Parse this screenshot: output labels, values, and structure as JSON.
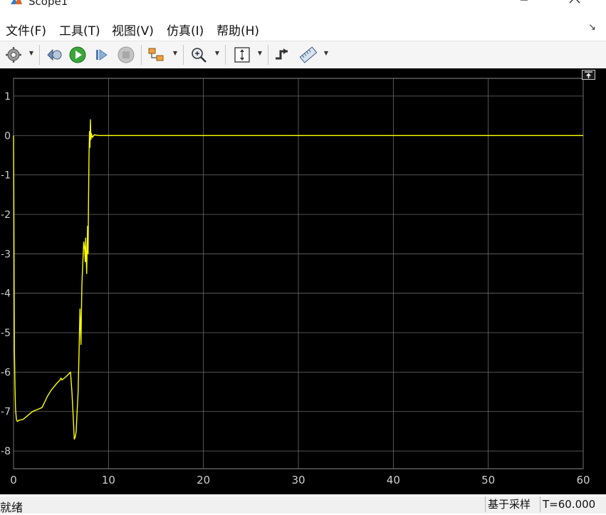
{
  "window": {
    "title": "Scope1"
  },
  "menu": {
    "items": [
      "文件(F)",
      "工具(T)",
      "视图(V)",
      "仿真(I)",
      "帮助(H)"
    ]
  },
  "status": {
    "left": "就绪",
    "mode": "基于采样",
    "time": "T=60.000"
  },
  "colors": {
    "trace": "#ffff00",
    "background": "#000000",
    "grid": "#6a6a6a",
    "axis_text": "#cfcfcf"
  },
  "chart_data": {
    "type": "line",
    "title": "",
    "xlabel": "",
    "ylabel": "",
    "xlim": [
      0,
      60
    ],
    "ylim": [
      -8.45,
      1.45
    ],
    "xticks": [
      0,
      10,
      20,
      30,
      40,
      50,
      60
    ],
    "yticks": [
      1,
      0,
      -1,
      -2,
      -3,
      -4,
      -5,
      -6,
      -7,
      -8
    ],
    "grid": true,
    "series": [
      {
        "color": "#ffff00",
        "x": [
          0,
          0.02,
          0.05,
          0.1,
          0.15,
          0.2,
          0.3,
          0.4,
          0.6,
          1.0,
          1.5,
          2.0,
          2.5,
          3.0,
          3.3,
          3.6,
          4.0,
          4.5,
          4.9,
          5.0,
          5.1,
          5.6,
          6.0,
          6.15,
          6.3,
          6.4,
          6.5,
          6.6,
          6.7,
          6.8,
          6.9,
          7.0,
          7.05,
          7.1,
          7.15,
          7.2,
          7.3,
          7.4,
          7.5,
          7.55,
          7.6,
          7.7,
          7.8,
          7.85,
          7.9,
          7.95,
          8.0,
          8.05,
          8.1,
          8.15,
          8.2,
          8.3,
          8.5,
          9.0,
          10.0,
          20.0,
          30.0,
          40.0,
          50.0,
          60.0
        ],
        "y": [
          0,
          -1.0,
          -3.0,
          -5.5,
          -6.3,
          -6.9,
          -7.2,
          -7.25,
          -7.22,
          -7.2,
          -7.1,
          -7.0,
          -6.95,
          -6.9,
          -6.75,
          -6.6,
          -6.45,
          -6.3,
          -6.2,
          -6.15,
          -6.2,
          -6.1,
          -6.0,
          -6.5,
          -7.2,
          -7.7,
          -7.65,
          -7.5,
          -7.0,
          -6.5,
          -5.5,
          -4.4,
          -4.8,
          -5.3,
          -4.5,
          -3.8,
          -3.2,
          -2.7,
          -2.9,
          -3.2,
          -2.6,
          -3.5,
          -2.3,
          -3.0,
          -1.7,
          -0.5,
          0.1,
          -0.3,
          0.4,
          -0.1,
          0.05,
          -0.05,
          0.02,
          0,
          0,
          0,
          0,
          0,
          0,
          0
        ]
      }
    ]
  }
}
